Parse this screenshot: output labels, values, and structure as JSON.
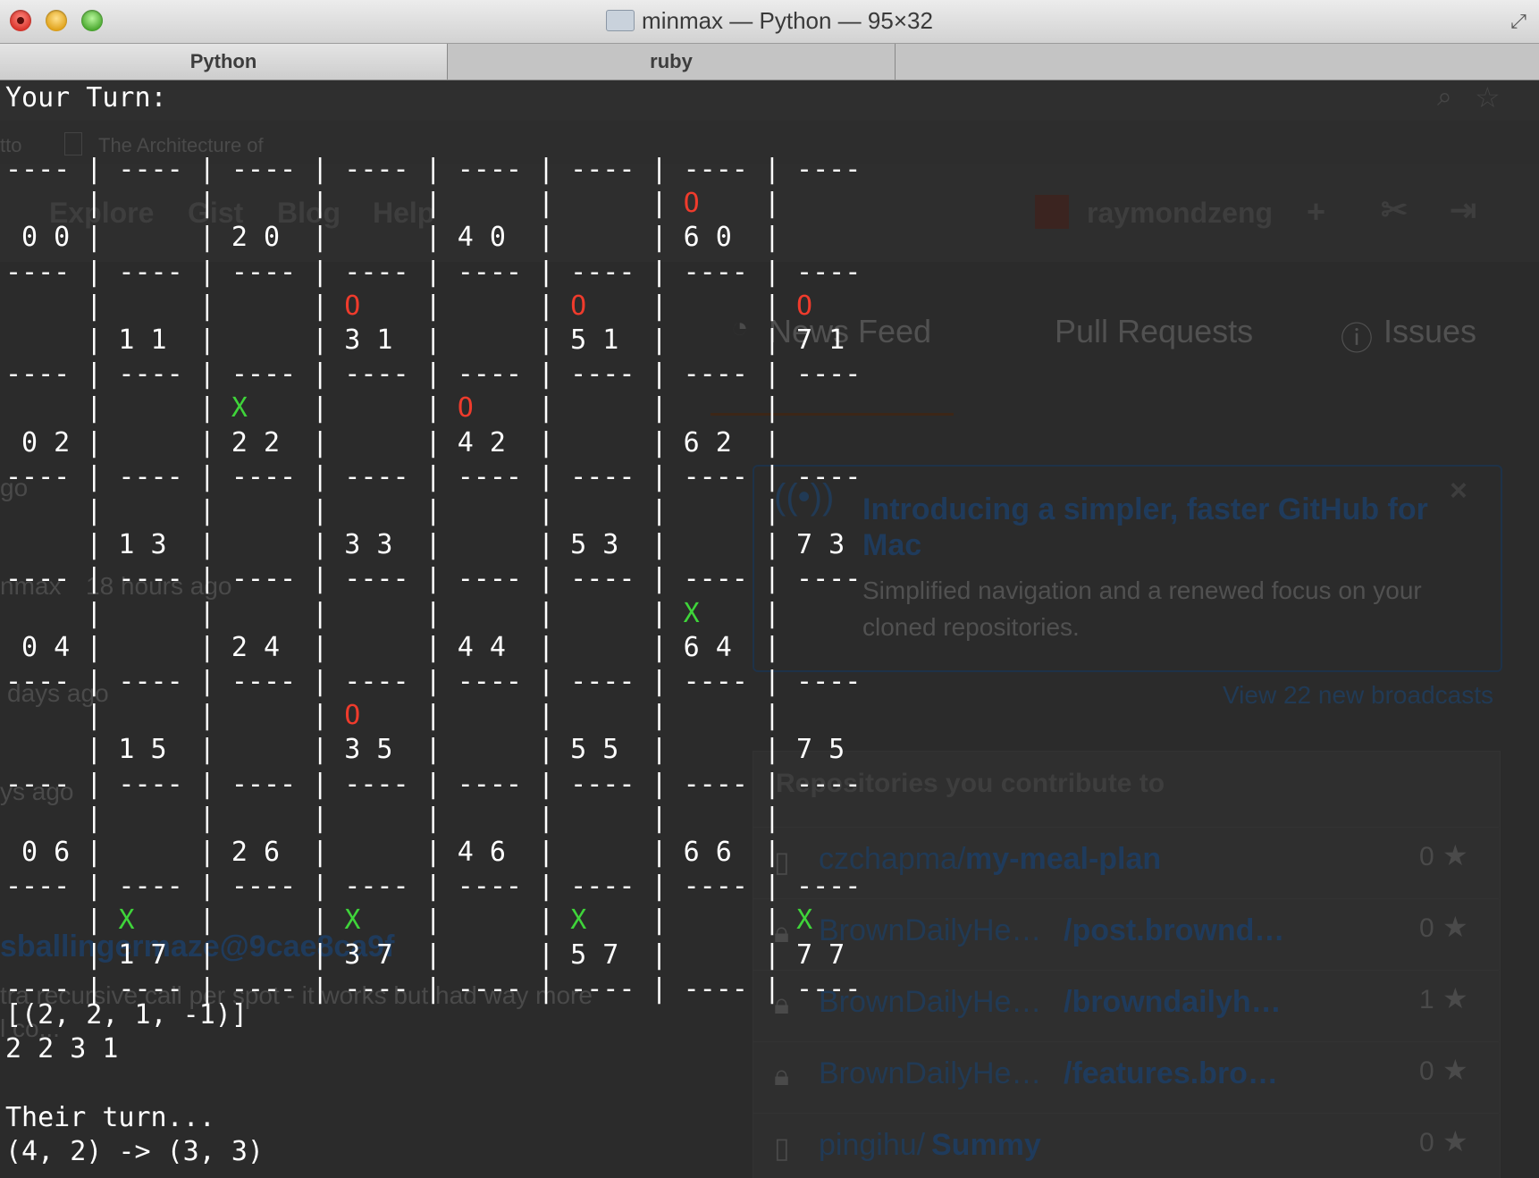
{
  "window": {
    "title": "minmax — Python — 95×32",
    "tabs": [
      {
        "label": "Python",
        "active": true
      },
      {
        "label": "ruby",
        "active": false
      }
    ]
  },
  "background": {
    "bookmark": "The Architecture of",
    "bookmark_prefix": "tto",
    "nav": [
      "Explore",
      "Gist",
      "Blog",
      "Help"
    ],
    "username": "raymondzeng",
    "plus": "+",
    "dashboard_tabs": [
      "News Feed",
      "Pull Requests",
      "Issues"
    ],
    "broadcast_title": "Introducing a simpler, faster GitHub for Mac",
    "broadcast_body": "Simplified navigation and a renewed focus on your cloned repositories.",
    "broadcast_close": "×",
    "view_broadcasts": "View 22 new broadcasts",
    "repos_heading": "Repositories you contribute to",
    "repos": [
      {
        "owner": "czchapma/",
        "name": "my-meal-plan",
        "stars": "0"
      },
      {
        "owner": "BrownDailyHe… ",
        "name": "/post.brownd…",
        "stars": "0"
      },
      {
        "owner": "BrownDailyHe… ",
        "name": "/browndailyh…",
        "stars": "1"
      },
      {
        "owner": "BrownDailyHe… ",
        "name": "/features.bro…",
        "stars": "0"
      },
      {
        "owner": "pingihu/",
        "name": "Summy",
        "stars": "0"
      }
    ],
    "feed_fragments": [
      "go",
      "nmax",
      "18 hours ago",
      "days ago",
      "ys ago",
      "sballingermaze@9cae8ca9f",
      "tra recursive call per spot - it works but had way more",
      "l co..."
    ]
  },
  "terminal": {
    "prompt": "Your Turn:",
    "grid_lines": [
      "---- | ---- | ---- | ---- | ---- | ---- | ---- | ----",
      "     |      |      |      |      |      | {R}    |",
      " 0 0 |      | 2 0  |      | 4 0  |      | 6 0  |",
      "---- | ---- | ---- | ---- | ---- | ---- | ---- | ----",
      "     |      |      | {R}    |      | {R}    |      | {R}",
      "     | 1 1  |      | 3 1  |      | 5 1  |      | 7 1",
      "---- | ---- | ---- | ---- | ---- | ---- | ---- | ----",
      "     |      | {G}    |      | {R}    |      |      |",
      " 0 2 |      | 2 2  |      | 4 2  |      | 6 2  |",
      "---- | ---- | ---- | ---- | ---- | ---- | ---- | ----",
      "     |      |      |      |      |      |      |",
      "     | 1 3  |      | 3 3  |      | 5 3  |      | 7 3",
      "---- | ---- | ---- | ---- | ---- | ---- | ---- | ----",
      "     |      |      |      |      |      | {G}    |",
      " 0 4 |      | 2 4  |      | 4 4  |      | 6 4  |",
      "---- | ---- | ---- | ---- | ---- | ---- | ---- | ----",
      "     |      |      | {R}    |      |      |      |",
      "     | 1 5  |      | 3 5  |      | 5 5  |      | 7 5",
      "---- | ---- | ---- | ---- | ---- | ---- | ---- | ----",
      "     |      |      |      |      |      |      |",
      " 0 6 |      | 2 6  |      | 4 6  |      | 6 6  |",
      "---- | ---- | ---- | ---- | ---- | ---- | ---- | ----",
      "     | {G}    |      | {G}    |      | {G}    |      | {G}",
      "     | 1 7  |      | 3 7  |      | 5 7  |      | 7 7",
      "---- | ---- | ---- | ---- | ---- | ---- | ---- | ----"
    ],
    "pieces": {
      "red": "O",
      "green": "X"
    },
    "moves_list": "[(2, 2, 1, -1)]",
    "move_input": "2 2 3 1",
    "their_turn": "Their turn...",
    "their_move": "(4, 2) -> (3, 3)"
  }
}
